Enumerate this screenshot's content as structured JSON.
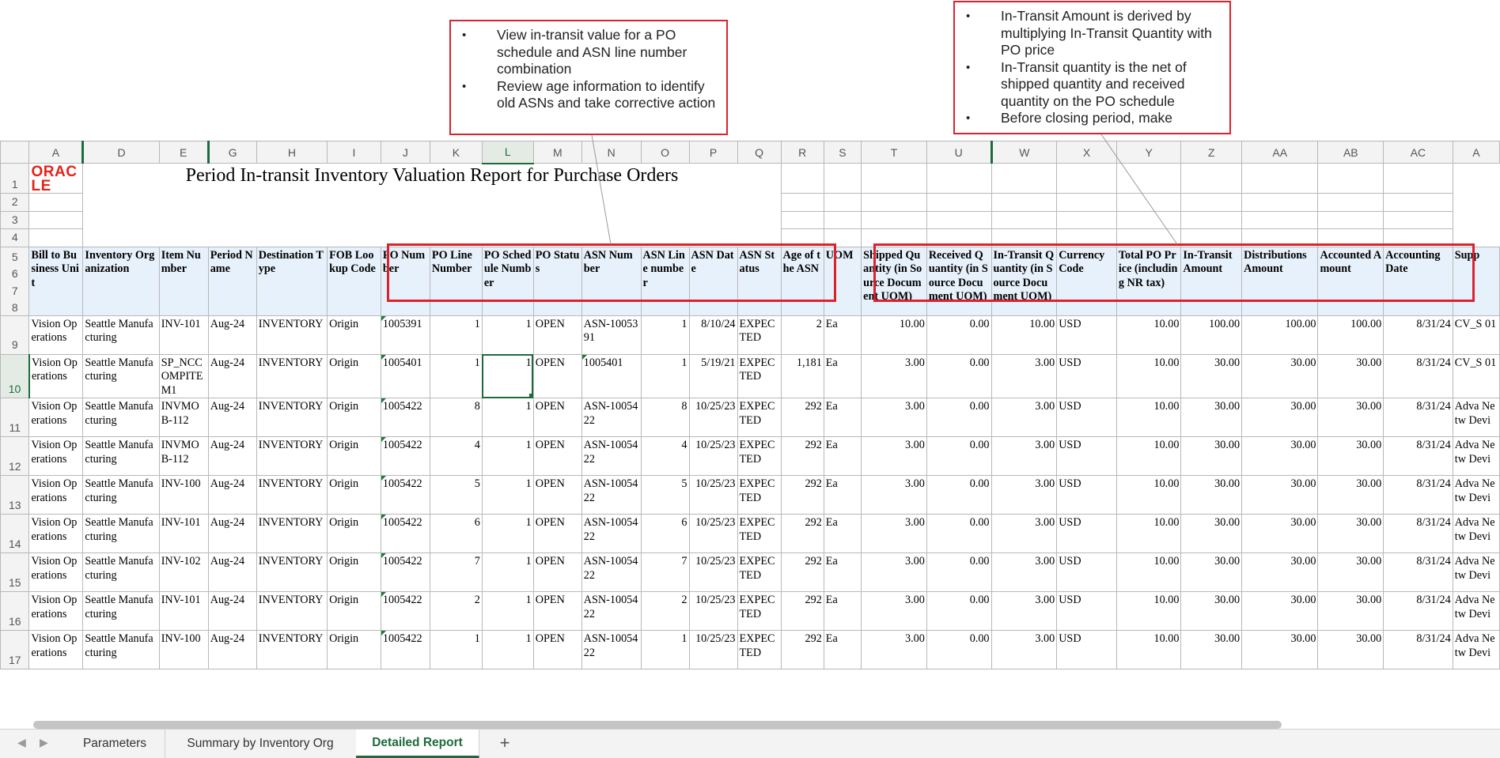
{
  "callouts": [
    {
      "items": [
        "View in-transit value for a PO schedule and ASN line number combination",
        "Review age information to identify old ASNs and take corrective action"
      ]
    },
    {
      "items": [
        "In-Transit Amount is derived by multiplying In-Transit Quantity with PO price",
        "In-Transit quantity is the net of shipped quantity and received quantity on the PO schedule",
        "Before closing period, make"
      ]
    }
  ],
  "logo": "ORACLE",
  "report_title": "Period In-transit Inventory Valuation Report for Purchase Orders",
  "columns": [
    "A",
    "D",
    "E",
    "G",
    "H",
    "I",
    "J",
    "K",
    "L",
    "M",
    "N",
    "O",
    "P",
    "Q",
    "R",
    "S",
    "T",
    "U",
    "W",
    "X",
    "Y",
    "Z",
    "AA",
    "AB",
    "AC",
    "A"
  ],
  "selected_column": "L",
  "header_rows": [
    "5",
    "6",
    "7",
    "8"
  ],
  "empty_rows": [
    "2",
    "3",
    "4"
  ],
  "headers": [
    "Bill to Business Unit",
    "Inventory Organization",
    "Item Number",
    "Period Name",
    "Destination Type",
    "FOB Lookup Code",
    "PO Number",
    "PO Line Number",
    "PO Schedule Number",
    "PO Status",
    "ASN Number",
    "ASN Line number",
    "ASN Date",
    "ASN Status",
    "Age of the ASN",
    "UOM",
    "Shipped Quantity (in Source Document UOM)",
    "Received Quantity (in Source Document UOM)",
    "In-Transit Quantity (in Source Document UOM)",
    "Currency Code",
    "Total PO Price (including NR tax)",
    "In-Transit Amount",
    "Distributions Amount",
    "Accounted Amount",
    "Accounting Date",
    "Supp"
  ],
  "rows": [
    {
      "num": "9",
      "cells": [
        "Vision Operations",
        "Seattle Manufacturing",
        "INV-101",
        "Aug-24",
        "INVENTORY",
        "Origin",
        "1005391",
        "1",
        "1",
        "OPEN",
        "ASN-1005391",
        "1",
        "8/10/24",
        "EXPECTED",
        "2",
        "Ea",
        "10.00",
        "0.00",
        "10.00",
        "USD",
        "10.00",
        "100.00",
        "100.00",
        "100.00",
        "8/31/24",
        "CV_S 01"
      ]
    },
    {
      "num": "10",
      "cells": [
        "Vision Operations",
        "Seattle Manufacturing",
        "SP_NCCOMPITEM1",
        "Aug-24",
        "INVENTORY",
        "Origin",
        "1005401",
        "1",
        "1",
        "OPEN",
        "1005401",
        "1",
        "5/19/21",
        "EXPECTED",
        "1,181",
        "Ea",
        "3.00",
        "0.00",
        "3.00",
        "USD",
        "10.00",
        "30.00",
        "30.00",
        "30.00",
        "8/31/24",
        "CV_S 01"
      ]
    },
    {
      "num": "11",
      "cells": [
        "Vision Operations",
        "Seattle Manufacturing",
        "INVMOB-112",
        "Aug-24",
        "INVENTORY",
        "Origin",
        "1005422",
        "8",
        "1",
        "OPEN",
        "ASN-1005422",
        "8",
        "10/25/23",
        "EXPECTED",
        "292",
        "Ea",
        "3.00",
        "0.00",
        "3.00",
        "USD",
        "10.00",
        "30.00",
        "30.00",
        "30.00",
        "8/31/24",
        "Adva Netw Devi"
      ]
    },
    {
      "num": "12",
      "cells": [
        "Vision Operations",
        "Seattle Manufacturing",
        "INVMOB-112",
        "Aug-24",
        "INVENTORY",
        "Origin",
        "1005422",
        "4",
        "1",
        "OPEN",
        "ASN-1005422",
        "4",
        "10/25/23",
        "EXPECTED",
        "292",
        "Ea",
        "3.00",
        "0.00",
        "3.00",
        "USD",
        "10.00",
        "30.00",
        "30.00",
        "30.00",
        "8/31/24",
        "Adva Netw Devi"
      ]
    },
    {
      "num": "13",
      "cells": [
        "Vision Operations",
        "Seattle Manufacturing",
        "INV-100",
        "Aug-24",
        "INVENTORY",
        "Origin",
        "1005422",
        "5",
        "1",
        "OPEN",
        "ASN-1005422",
        "5",
        "10/25/23",
        "EXPECTED",
        "292",
        "Ea",
        "3.00",
        "0.00",
        "3.00",
        "USD",
        "10.00",
        "30.00",
        "30.00",
        "30.00",
        "8/31/24",
        "Adva Netw Devi"
      ]
    },
    {
      "num": "14",
      "cells": [
        "Vision Operations",
        "Seattle Manufacturing",
        "INV-101",
        "Aug-24",
        "INVENTORY",
        "Origin",
        "1005422",
        "6",
        "1",
        "OPEN",
        "ASN-1005422",
        "6",
        "10/25/23",
        "EXPECTED",
        "292",
        "Ea",
        "3.00",
        "0.00",
        "3.00",
        "USD",
        "10.00",
        "30.00",
        "30.00",
        "30.00",
        "8/31/24",
        "Adva Netw Devi"
      ]
    },
    {
      "num": "15",
      "cells": [
        "Vision Operations",
        "Seattle Manufacturing",
        "INV-102",
        "Aug-24",
        "INVENTORY",
        "Origin",
        "1005422",
        "7",
        "1",
        "OPEN",
        "ASN-1005422",
        "7",
        "10/25/23",
        "EXPECTED",
        "292",
        "Ea",
        "3.00",
        "0.00",
        "3.00",
        "USD",
        "10.00",
        "30.00",
        "30.00",
        "30.00",
        "8/31/24",
        "Adva Netw Devi"
      ]
    },
    {
      "num": "16",
      "cells": [
        "Vision Operations",
        "Seattle Manufacturing",
        "INV-101",
        "Aug-24",
        "INVENTORY",
        "Origin",
        "1005422",
        "2",
        "1",
        "OPEN",
        "ASN-1005422",
        "2",
        "10/25/23",
        "EXPECTED",
        "292",
        "Ea",
        "3.00",
        "0.00",
        "3.00",
        "USD",
        "10.00",
        "30.00",
        "30.00",
        "30.00",
        "8/31/24",
        "Adva Netw Devi"
      ]
    },
    {
      "num": "17",
      "cells": [
        "Vision Operations",
        "Seattle Manufacturing",
        "INV-100",
        "Aug-24",
        "INVENTORY",
        "Origin",
        "1005422",
        "1",
        "1",
        "OPEN",
        "ASN-1005422",
        "1",
        "10/25/23",
        "EXPECTED",
        "292",
        "Ea",
        "3.00",
        "0.00",
        "3.00",
        "USD",
        "10.00",
        "30.00",
        "30.00",
        "30.00",
        "8/31/24",
        "Adva Netw Devi"
      ]
    }
  ],
  "tabs": [
    "Parameters",
    "Summary by Inventory Org",
    "Detailed Report"
  ],
  "active_tab": "Detailed Report",
  "add_tab_label": "+",
  "colors": {
    "highlight_box": "#d9232e",
    "header_fill": "#e7f1fb",
    "selection": "#1d6b3c",
    "logo": "#e2231a"
  }
}
